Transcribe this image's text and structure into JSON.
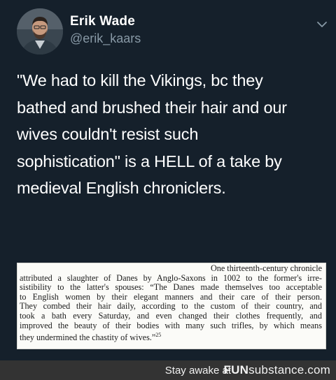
{
  "tweet": {
    "author_name": "Erik Wade",
    "author_handle": "@erik_kaars",
    "avatar_icon": "profile-photo",
    "menu_icon": "chevron-down-icon",
    "text_lines": [
      "\"We had to kill the Vikings, bc they",
      "bathed and brushed their hair and our",
      "wives couldn't resist such",
      "sophistication\" is a HELL of a take by",
      "medieval English chroniclers."
    ]
  },
  "excerpt": {
    "lines": [
      "One thirteenth-century chronicle",
      "attributed a slaughter of Danes by Anglo-Saxons in 1002 to the former's irre-",
      "sistibility to the latter's spouses: “The Danes made themselves too acceptable",
      "to English women by their elegant manners and their care of their person.",
      "They combed their hair daily, according to the custom of their country, and",
      "took a bath every Saturday, and even changed their clothes frequently, and",
      "improved the beauty of their bodies with many such trifles, by which means",
      "they undermined the chastity of wives.”"
    ],
    "footnote": "25"
  },
  "footer": {
    "tagline": "Stay awake at",
    "logo_part1": "FUN",
    "logo_part2": "substance.com"
  },
  "colors": {
    "background": "#15202b",
    "name": "#ffffff",
    "handle": "#8899a6",
    "footer_bg": "#333333"
  }
}
